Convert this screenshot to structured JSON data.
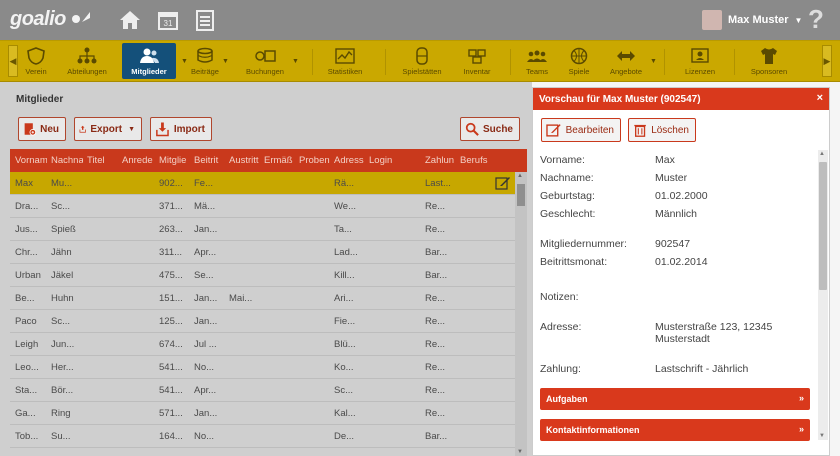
{
  "topbar": {
    "logo": "goalio",
    "user_name": "Max Muster",
    "help": "?"
  },
  "nav": {
    "items": [
      {
        "label": "Verein",
        "icon": "shield-icon"
      },
      {
        "label": "Abteilungen",
        "icon": "org-chart-icon"
      },
      {
        "label": "Mitglieder",
        "icon": "members-icon",
        "active": true
      },
      {
        "label": "Beiträge",
        "icon": "coins-icon"
      },
      {
        "label": "Buchungen",
        "icon": "cash-icon"
      },
      {
        "label": "Statistiken",
        "icon": "chart-icon"
      },
      {
        "label": "Spielstätten",
        "icon": "venue-icon"
      },
      {
        "label": "Inventar",
        "icon": "boxes-icon"
      },
      {
        "label": "Teams",
        "icon": "teams-icon"
      },
      {
        "label": "Spiele",
        "icon": "ball-icon"
      },
      {
        "label": "Angebote",
        "icon": "offers-icon"
      },
      {
        "label": "Lizenzen",
        "icon": "license-icon"
      },
      {
        "label": "Sponsoren",
        "icon": "shirt-icon"
      }
    ]
  },
  "main": {
    "title": "Mitglieder",
    "buttons": {
      "new": "Neu",
      "export": "Export",
      "import": "Import",
      "search": "Suche"
    },
    "columns": [
      "Vornam",
      "Nachna",
      "Titel",
      "Anrede",
      "Mitglie",
      "Beitrit",
      "Austritt",
      "Ermäß",
      "Proben",
      "Adress",
      "Login",
      "Zahlun",
      "Berufs"
    ],
    "rows": [
      {
        "first": "Max",
        "last": "Mu...",
        "nr": "902...",
        "join": "Fe...",
        "exit": "",
        "addr": "Rä...",
        "pay": "Last..."
      },
      {
        "first": "Dra...",
        "last": "Sc...",
        "nr": "371...",
        "join": "Mä...",
        "exit": "",
        "addr": "We...",
        "pay": "Re..."
      },
      {
        "first": "Jus...",
        "last": "Spieß",
        "nr": "263...",
        "join": "Jan...",
        "exit": "",
        "addr": "Ta...",
        "pay": "Re..."
      },
      {
        "first": "Chr...",
        "last": "Jähn",
        "nr": "311...",
        "join": "Apr...",
        "exit": "",
        "addr": "Lad...",
        "pay": "Bar..."
      },
      {
        "first": "Urban",
        "last": "Jäkel",
        "nr": "475...",
        "join": "Se...",
        "exit": "",
        "addr": "Kill...",
        "pay": "Bar..."
      },
      {
        "first": "Be...",
        "last": "Huhn",
        "nr": "151...",
        "join": "Jan...",
        "exit": "Mai...",
        "addr": "Ari...",
        "pay": "Re..."
      },
      {
        "first": "Paco",
        "last": "Sc...",
        "nr": "125...",
        "join": "Jan...",
        "exit": "",
        "addr": "Fie...",
        "pay": "Re..."
      },
      {
        "first": "Leigh",
        "last": "Jun...",
        "nr": "674...",
        "join": "Jul ...",
        "exit": "",
        "addr": "Blü...",
        "pay": "Re..."
      },
      {
        "first": "Leo...",
        "last": "Her...",
        "nr": "541...",
        "join": "No...",
        "exit": "",
        "addr": "Ko...",
        "pay": "Re..."
      },
      {
        "first": "Sta...",
        "last": "Bör...",
        "nr": "541...",
        "join": "Apr...",
        "exit": "",
        "addr": "Sc...",
        "pay": "Re..."
      },
      {
        "first": "Ga...",
        "last": "Ring",
        "nr": "571...",
        "join": "Jan...",
        "exit": "",
        "addr": "Kal...",
        "pay": "Re..."
      },
      {
        "first": "Tob...",
        "last": "Su...",
        "nr": "164...",
        "join": "No...",
        "exit": "",
        "addr": "De...",
        "pay": "Bar..."
      }
    ]
  },
  "panel": {
    "title": "Vorschau für Max Muster (902547)",
    "close": "×",
    "edit": "Bearbeiten",
    "delete": "Löschen",
    "fields": {
      "firstname_label": "Vorname:",
      "firstname": "Max",
      "lastname_label": "Nachname:",
      "lastname": "Muster",
      "birthday_label": "Geburtstag:",
      "birthday": "01.02.2000",
      "gender_label": "Geschlecht:",
      "gender": "Männlich",
      "memberno_label": "Mitgliedernummer:",
      "memberno": "902547",
      "joinmonth_label": "Beitrittsmonat:",
      "joinmonth": "01.02.2014",
      "notes_label": "Notizen:",
      "address_label": "Adresse:",
      "address": "Musterstraße 123, 12345 Musterstadt",
      "payment_label": "Zahlung:",
      "payment": "Lastschrift - Jährlich"
    },
    "sections": [
      "Aufgaben",
      "Kontaktinformationen"
    ]
  }
}
